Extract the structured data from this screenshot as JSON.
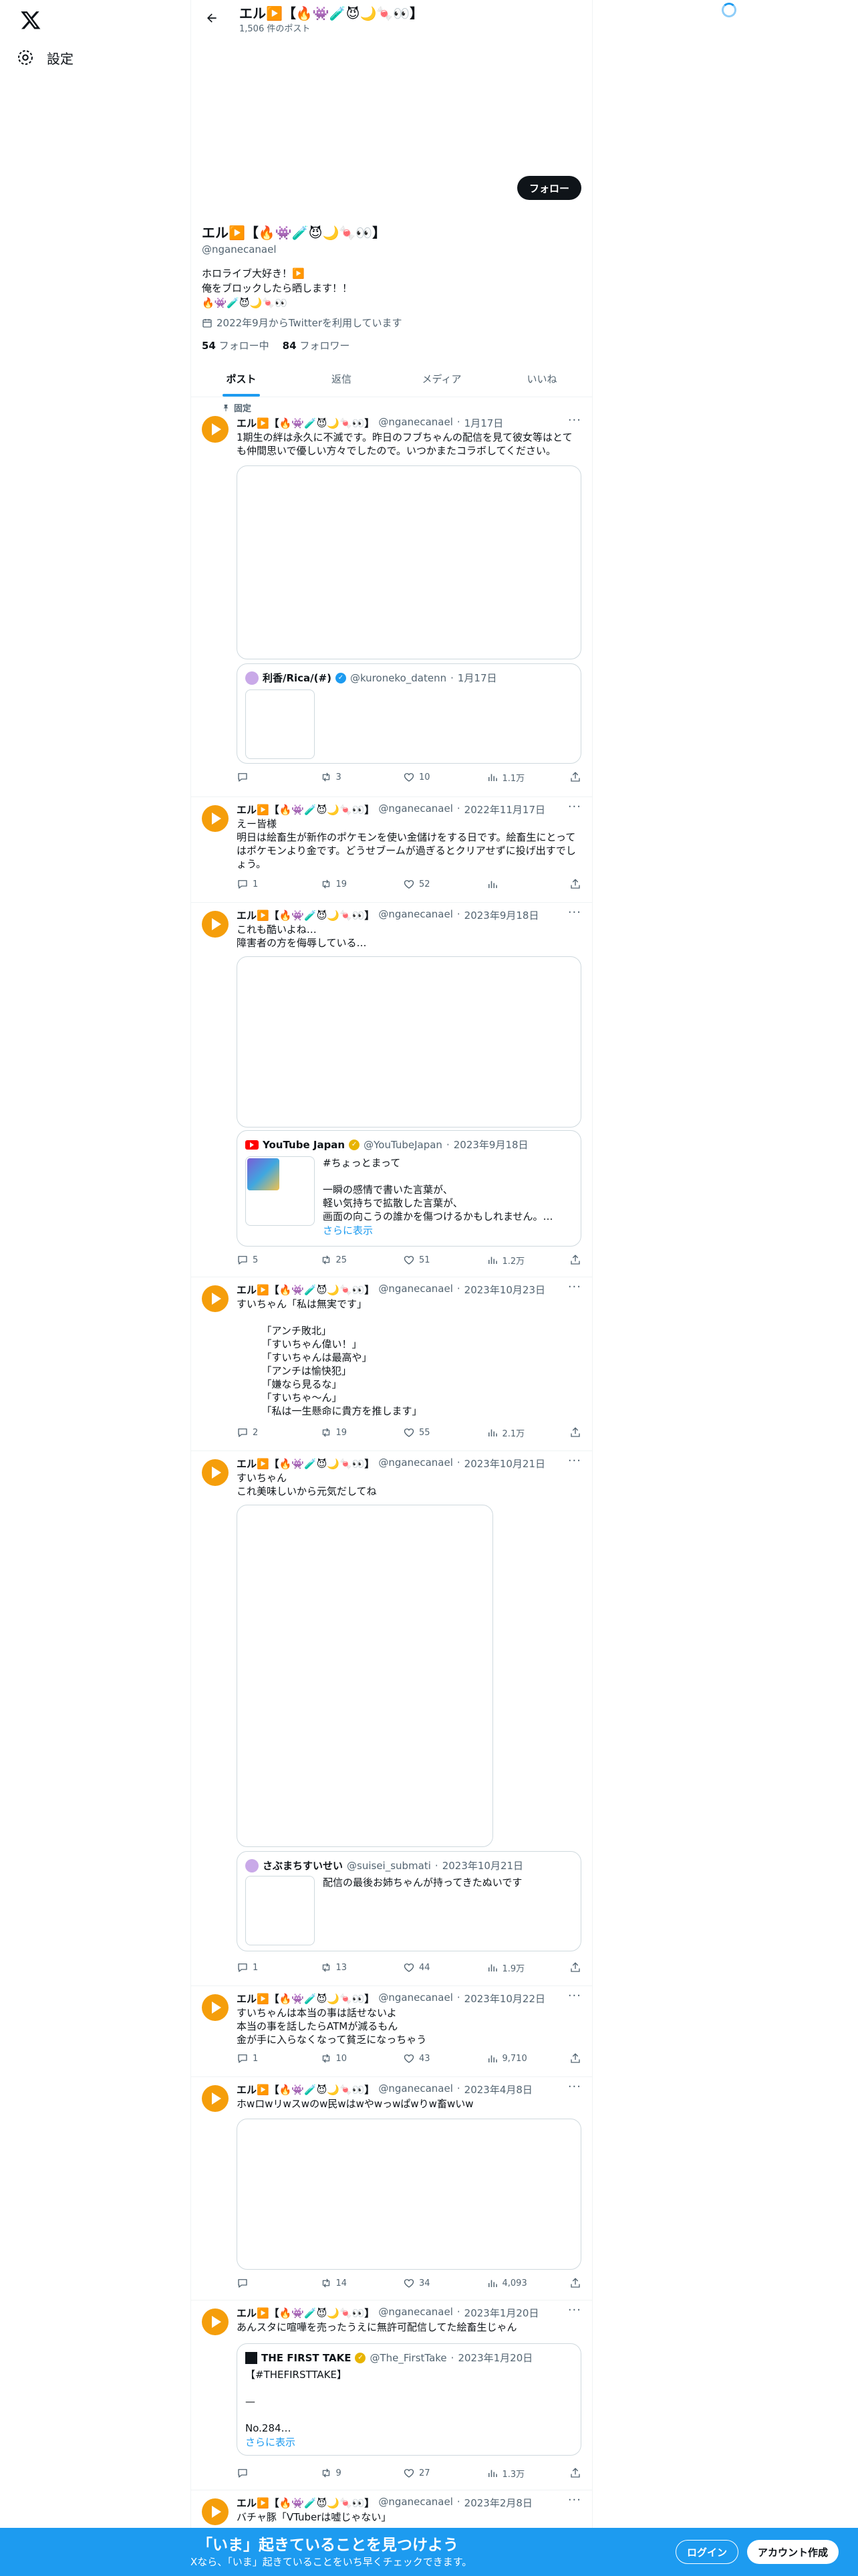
{
  "nav": {
    "settings_label": "設定"
  },
  "header": {
    "name": "エル▶️【🔥👾🧪😈🌙🍬👀】",
    "post_count": "1,506 件のポスト"
  },
  "profile": {
    "follow_label": "フォロー",
    "name": "エル▶️【🔥👾🧪😈🌙🍬👀】",
    "handle": "@nganecanael",
    "bio": "ホロライブ大好き！▶️\n俺をブロックしたら晒します！！\n🔥👾🧪😈🌙🍬👀",
    "joined": "2022年9月からTwitterを利用しています",
    "following_count": "54",
    "following_label": "フォロー中",
    "followers_count": "84",
    "followers_label": "フォロワー"
  },
  "tabs": [
    "ポスト",
    "返信",
    "メディア",
    "いいね"
  ],
  "pinned_label": "固定",
  "tweets": [
    {
      "name": "エル▶️【🔥👾🧪😈🌙🍬👀】",
      "handle": "@nganecanael",
      "date": "1月17日",
      "text": "1期生の絆は永久に不滅です。昨日のフブちゃんの配信を見て彼女等はとても仲間思いで優しい方々でしたので。いつかまたコラボしてください。",
      "quote": {
        "name": "利香/Rica/(#)",
        "handle": "@kuroneko_datenn",
        "date": "1月17日",
        "text": ""
      },
      "reply": "",
      "retweet": "3",
      "like": "10",
      "views": "1.1万"
    },
    {
      "name": "エル▶️【🔥👾🧪😈🌙🍬👀】",
      "handle": "@nganecanael",
      "date": "2022年11月17日",
      "text": "えー皆様\n明日は絵畜生が新作のポケモンを使い金儲けをする日です。絵畜生にとってはポケモンより金です。どうせブームが過ぎるとクリアせずに投げ出すでしょう。",
      "reply": "1",
      "retweet": "19",
      "like": "52",
      "views": ""
    },
    {
      "name": "エル▶️【🔥👾🧪😈🌙🍬👀】",
      "handle": "@nganecanael",
      "date": "2023年9月18日",
      "text": "これも酷いよね…\n障害者の方を侮辱している…",
      "quote": {
        "name": "YouTube Japan",
        "handle": "@YouTubeJapan",
        "date": "2023年9月18日",
        "text": "#ちょっとまって\n\n一瞬の感情で書いた言葉が、\n軽い気持ちで拡散した言葉が、\n画面の向こうの誰かを傷つけるかもしれません。…",
        "more": "さらに表示"
      },
      "reply": "5",
      "retweet": "25",
      "like": "51",
      "views": "1.2万"
    },
    {
      "name": "エル▶️【🔥👾🧪😈🌙🍬👀】",
      "handle": "@nganecanael",
      "date": "2023年10月23日",
      "text": "すいちゃん「私は無実です」\n\n　　　「アンチ敗北」\n　　　「すいちゃん偉い！」\n　　　「すいちゃんは最高や」\n　　　「アンチは愉快犯」\n　　　「嫌なら見るな」\n　　　「すいちゃ〜ん」\n　　　「私は一生懸命に貴方を推します」",
      "reply": "2",
      "retweet": "19",
      "like": "55",
      "views": "2.1万"
    },
    {
      "name": "エル▶️【🔥👾🧪😈🌙🍬👀】",
      "handle": "@nganecanael",
      "date": "2023年10月21日",
      "text": "すいちゃん\nこれ美味しいから元気だしてね",
      "quote": {
        "name": "さぶまちすいせい",
        "handle": "@suisei_submati",
        "date": "2023年10月21日",
        "text": "配信の最後お姉ちゃんが持ってきたぬいです"
      },
      "reply": "1",
      "retweet": "13",
      "like": "44",
      "views": "1.9万"
    },
    {
      "name": "エル▶️【🔥👾🧪😈🌙🍬👀】",
      "handle": "@nganecanael",
      "date": "2023年10月22日",
      "text": "すいちゃんは本当の事は話せないよ\n本当の事を話したらATMが減るもん\n金が手に入らなくなって貧乏になっちゃう",
      "reply": "1",
      "retweet": "10",
      "like": "43",
      "views": "9,710"
    },
    {
      "name": "エル▶️【🔥👾🧪😈🌙🍬👀】",
      "handle": "@nganecanael",
      "date": "2023年4月8日",
      "text": "ホwロwリwスwのw民wはwやwっwぱwりw畜wいw",
      "reply": "",
      "retweet": "14",
      "like": "34",
      "views": "4,093"
    },
    {
      "name": "エル▶️【🔥👾🧪😈🌙🍬👀】",
      "handle": "@nganecanael",
      "date": "2023年1月20日",
      "text": "あんスタに喧嘩を売ったうえに無許可配信してた絵畜生じゃん",
      "quote": {
        "name": "THE FIRST TAKE",
        "handle": "@The_FirstTake",
        "date": "2023年1月20日",
        "text": "【#THEFIRSTTAKE】\n\n—\n\nNo.284…",
        "more": "さらに表示"
      },
      "reply": "",
      "retweet": "9",
      "like": "27",
      "views": "1.3万"
    },
    {
      "name": "エル▶️【🔥👾🧪😈🌙🍬👀】",
      "handle": "@nganecanael",
      "date": "2023年2月8日",
      "text": "バチャ豚「VTuberは嘘じゃない」"
    }
  ],
  "bottom_bar": {
    "title": "「いま」起きていることを見つけよう",
    "subtitle": "Xなら、「いま」起きていることをいち早くチェックできます。",
    "login_label": "ログイン",
    "signup_label": "アカウント作成"
  },
  "colors": {
    "accent": "#1d9bf0",
    "text": "#0f1419",
    "muted": "#536471",
    "border": "#cfd9de",
    "avatar": "#f59e0b"
  },
  "icons": [
    "x-logo-icon",
    "settings-icon",
    "back-arrow-icon",
    "calendar-icon",
    "pin-icon",
    "reply-icon",
    "retweet-icon",
    "like-icon",
    "views-icon",
    "share-icon",
    "more-icon",
    "verified-icon"
  ]
}
